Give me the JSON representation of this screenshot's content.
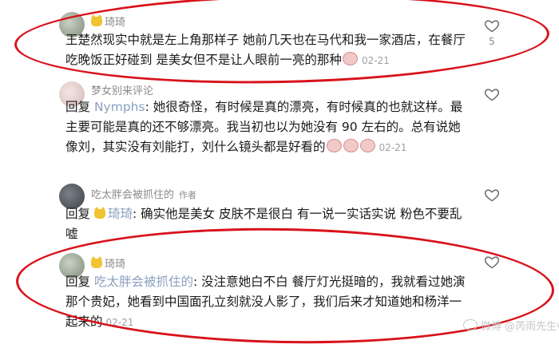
{
  "comments": [
    {
      "username": "琦琦",
      "text": "王楚然现实中就是左上角那样子 她前几天也在马代和我一家酒店，在餐厅吃晚饭正好碰到 是美女但不是让人眼前一亮的那种",
      "date": "02-21",
      "likes": "5"
    },
    {
      "username": "梦女别来评论",
      "reply_prefix": "回复",
      "mention": "Nymphs",
      "text": ": 她很奇怪，有时候是真的漂亮，有时候真的也就这样。最主要可能是真的还不够漂亮。我当初也以为她没有 90 左右的。总有说她像刘，其实没有刘能打，刘什么镜头都是好看的",
      "date": "02-21"
    },
    {
      "username": "吃太胖会被抓住的",
      "author_tag": "作者",
      "reply_prefix": "回复",
      "mention": "琦琦",
      "text": ": 确实他是美女 皮肤不是很白 有一说一实话实说 粉色不要乱嘘"
    },
    {
      "username": "琦琦",
      "reply_prefix": "回复",
      "mention": "吃太胖会被抓住的",
      "text": ": 没注意她白不白 餐厅灯光挺暗的，我就看过她演那个贵妃，她看到中国面孔立刻就没人影了，我们后来才知道她和杨洋一起来的",
      "date": "02-21"
    }
  ],
  "watermark": "微博 @芮雨先生v",
  "colors": {
    "highlight": "#d8121b",
    "mention": "#8aa0c0",
    "meta": "#8a8a8a"
  }
}
